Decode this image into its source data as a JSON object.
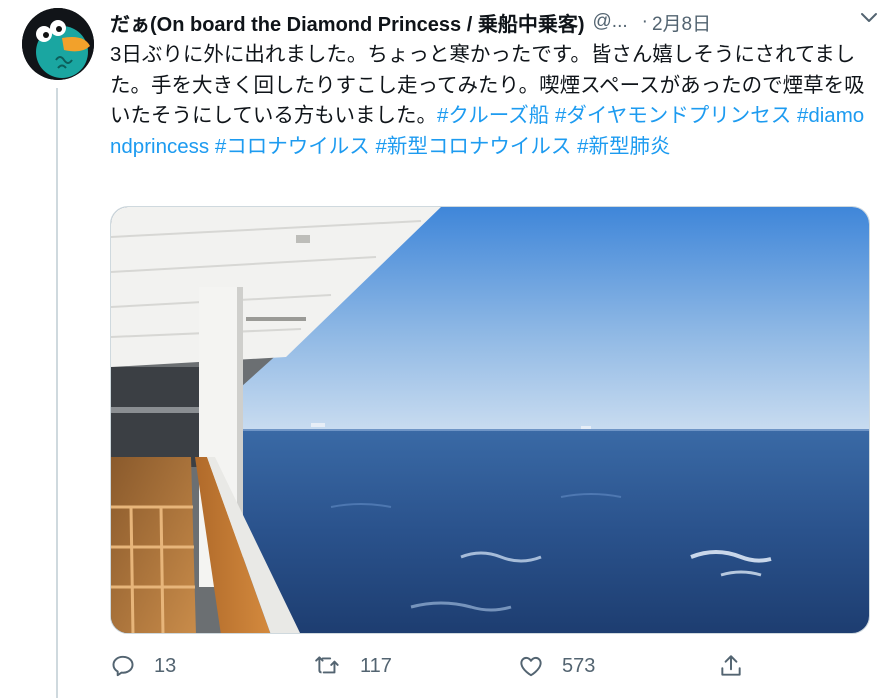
{
  "tweet": {
    "display_name": "だぁ(On board the Diamond Princess / 乗船中乗客)",
    "handle": "@...",
    "separator": "·",
    "date": "2月8日",
    "body_text": "3日ぶりに外に出れました。ちょっと寒かったです。皆さん嬉しそうにされてました。手を大きく回したりすこし走ってみたり。喫煙スペースがあったので煙草を吸いたそうにしている方もいました。",
    "hashtags": [
      "#クルーズ船",
      "#ダイヤモンドプリンセス",
      "#diamondprincess",
      "#コロナウイルス",
      "#新型コロナウイルス",
      "#新型肺炎"
    ]
  },
  "actions": {
    "reply_count": "13",
    "retweet_count": "117",
    "like_count": "573"
  },
  "icons": {
    "more": "chevron-down-icon",
    "reply": "reply-icon",
    "retweet": "retweet-icon",
    "like": "heart-icon",
    "share": "share-icon"
  },
  "colors": {
    "hashtag": "#1d9bf0",
    "secondary_text": "#536471",
    "primary_text": "#0f1419",
    "avatar_character": "#1aa6a1",
    "avatar_beak": "#f2a12b"
  }
}
